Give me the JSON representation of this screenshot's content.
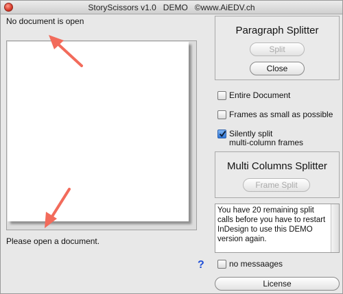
{
  "window": {
    "title": "StoryScissors v1.0   DEMO   ©www.AiEDV.ch"
  },
  "status": {
    "top": "No document is open",
    "bottom": "Please open a document."
  },
  "paragraph_splitter": {
    "title": "Paragraph Splitter",
    "split_label": "Split",
    "close_label": "Close"
  },
  "options": {
    "entire_document": {
      "label": "Entire Document",
      "checked": false
    },
    "frames_small": {
      "label": "Frames as small as possible",
      "checked": false
    },
    "silently_split": {
      "label_line1": "Silently split",
      "label_line2": "multi-column frames",
      "checked": true
    }
  },
  "multi_columns_splitter": {
    "title": "Multi Columns Splitter",
    "frame_split_label": "Frame Split"
  },
  "message": "You have 20 remaining split calls before you have to restart InDesign to use this DEMO version again.",
  "no_messages": {
    "label": "no messaages",
    "checked": false
  },
  "help_label": "?",
  "license_label": "License",
  "colors": {
    "annotation_arrow": "#f26b5b",
    "help": "#1f4fd8",
    "checkbox_checked": "#2f76d6"
  }
}
